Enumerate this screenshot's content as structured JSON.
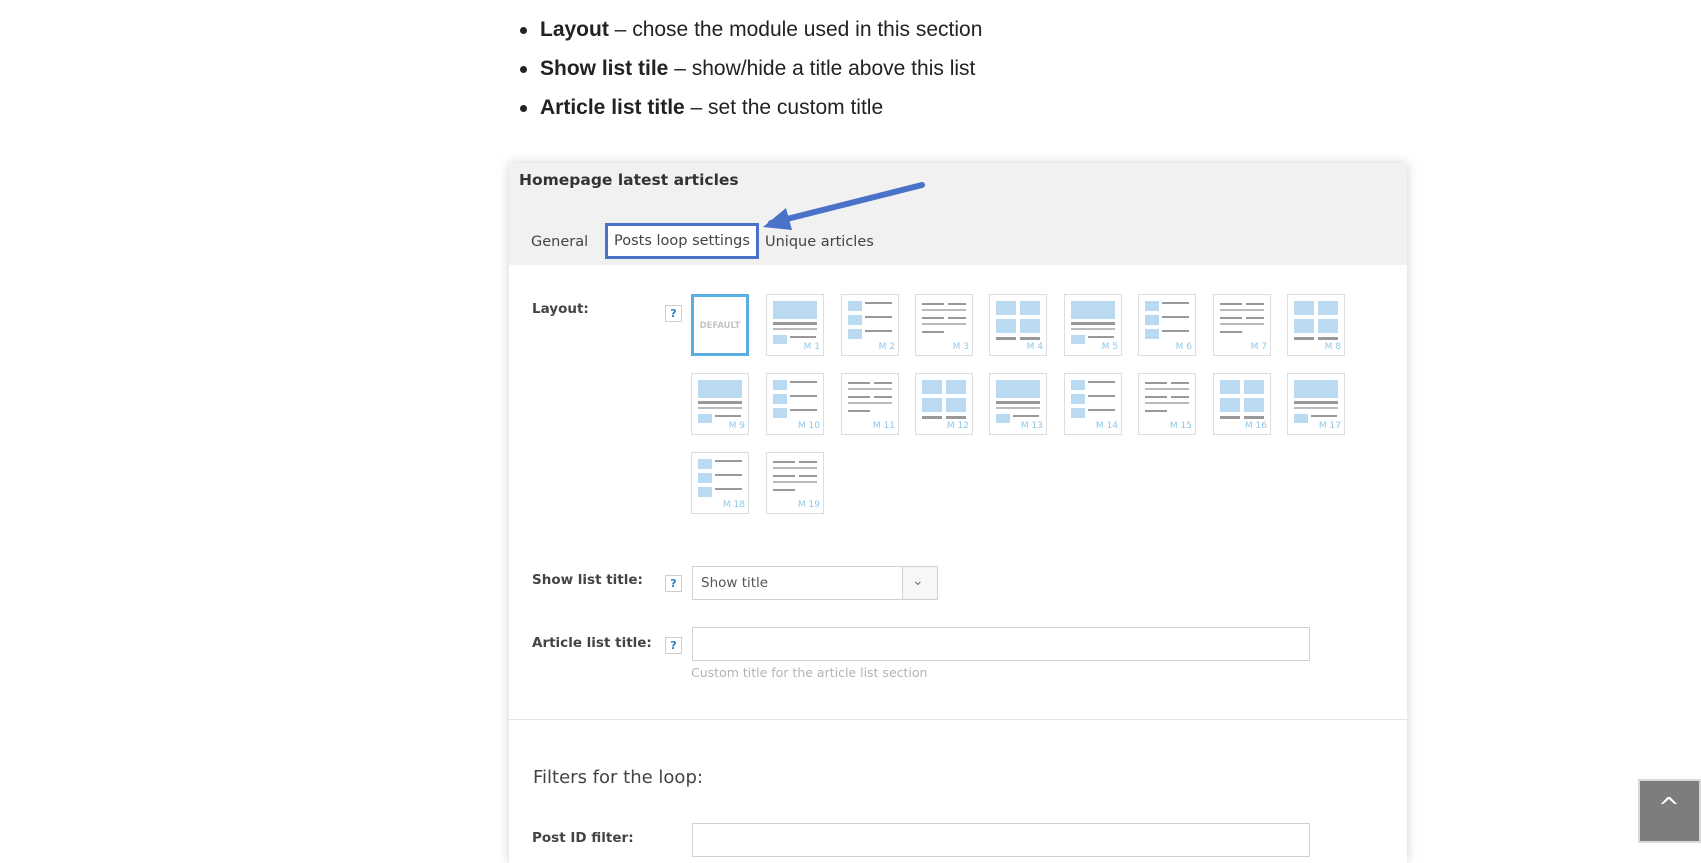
{
  "bullets": [
    {
      "term": "Layout",
      "desc": " – chose the module used in this section"
    },
    {
      "term": "Show list tile",
      "desc": " – show/hide a title above this list"
    },
    {
      "term": "Article list title",
      "desc": " – set the custom title"
    }
  ],
  "panel": {
    "title": "Homepage latest articles",
    "tabs": {
      "general": "General",
      "loop": "Posts loop settings",
      "unique": "Unique articles"
    },
    "layout_label": "Layout:",
    "help": "?",
    "default_thumb": "DEFAULT",
    "modules": [
      "M 1",
      "M 2",
      "M 3",
      "M 4",
      "M 5",
      "M 6",
      "M 7",
      "M 8",
      "M 9",
      "M 10",
      "M 11",
      "M 12",
      "M 13",
      "M 14",
      "M 15",
      "M 16",
      "M 17",
      "M 18",
      "M 19"
    ],
    "show_title_label": "Show list title:",
    "show_title_value": "Show title",
    "article_title_label": "Article list title:",
    "article_title_value": "",
    "article_title_hint": "Custom title for the article list section",
    "filters_heading": "Filters for the loop:",
    "post_id_label": "Post ID filter:",
    "post_id_value": ""
  },
  "colors": {
    "accent_outline": "#4a72c8",
    "selected_thumb": "#5aaee2",
    "thumb_block": "#b9daf0"
  },
  "icons": {
    "arrow": "arrow-pointer-icon",
    "dropdown": "chevron-down-icon",
    "scroll_top": "chevron-up-icon"
  }
}
